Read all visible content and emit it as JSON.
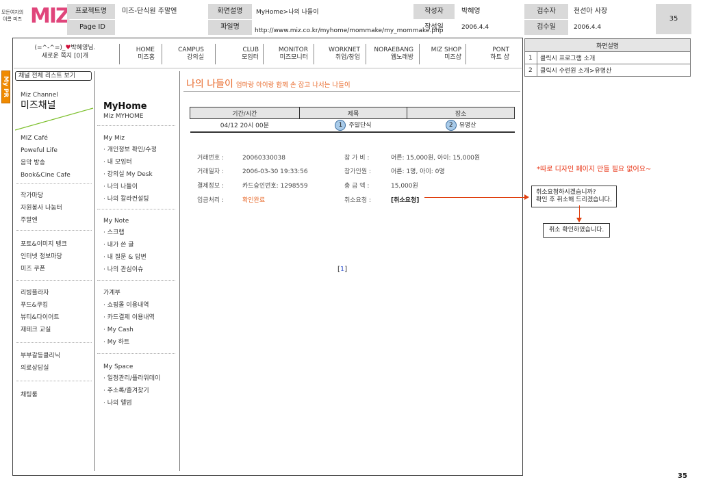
{
  "header": {
    "logo_line1": "모든여자의",
    "logo_line2": "이름 미즈",
    "logo_text": "MIZ",
    "project_label": "프로젝트명",
    "project_value": "미즈-단식원 주말엔",
    "screen_desc_label": "화면설명",
    "screen_desc_value": "MyHome>나의 나들이",
    "author_label": "작성자",
    "author_value": "박혜영",
    "reviewer_label": "검수자",
    "reviewer_value": "천선아 사장",
    "page_no": "35",
    "page_id_label": "Page ID",
    "file_label": "파일명",
    "file_value": "http://www.miz.co.kr/myhome/mommake/my_mommake.php",
    "created_label": "작성일",
    "created_value": "2006.4.4",
    "reviewed_label": "검수일",
    "reviewed_value": "2006.4.4"
  },
  "topnav": {
    "user_line1_a": "(=^-^=)_",
    "user_line1_b": "박혜영님.",
    "user_line2": "새로운 쪽지 [0]개",
    "items": [
      {
        "en": "HOME",
        "ko": "미즈홈"
      },
      {
        "en": "CAMPUS",
        "ko": "강의실"
      },
      {
        "en": "CLUB",
        "ko": "모임터"
      },
      {
        "en": "MONITOR",
        "ko": "미즈모니터"
      },
      {
        "en": "WORKNET",
        "ko": "취업/창업"
      },
      {
        "en": "NORAEBANG",
        "ko": "웹노래방"
      },
      {
        "en": "MIZ SHOP",
        "ko": "미즈샵"
      },
      {
        "en": "PONT",
        "ko": "하트 샵"
      }
    ]
  },
  "sidebar": {
    "tab": "My PR",
    "list_button": "채널 전체 리스트 보기",
    "channel_en": "Miz Channel",
    "channel_ko": "미즈채널",
    "group1": [
      "MIZ Café",
      "Poweful Life",
      "음악 방송",
      "Book&Cine Cafe"
    ],
    "group2": [
      "작가마당",
      "자원봉사 나눔터",
      "주말엔"
    ],
    "group3": [
      "포토&이미지 뱅크",
      "인터넷 정보마당",
      "미즈 쿠폰"
    ],
    "group4": [
      "리빙플라자",
      "푸드&쿠킹",
      "뷰티&다이어트",
      "재테크 교실"
    ],
    "group5": [
      "부부갈등클리닉",
      "의료상담실"
    ],
    "group6": [
      "채팅룸"
    ]
  },
  "myhome": {
    "title": "MyHome",
    "subtitle": "Miz MYHOME",
    "mymiz_title": "My Miz",
    "mymiz": [
      "· 개인정보 확인/수정",
      "· 내 모임터",
      "· 강의실 My Desk",
      "· 나의 나들이",
      "· 나의 칼라컨설팅"
    ],
    "mynote_title": "My Note",
    "mynote": [
      "· 스크랩",
      "· 내가 쓴 글",
      "· 내 질문 & 답변",
      "· 나의 관심이슈"
    ],
    "ledger_title": "가계부",
    "ledger": [
      "· 쇼핑몰 이용내역",
      "· 카드결제 이용내역",
      "· My Cash",
      "· My 하트"
    ],
    "myspace_title": "My Space",
    "myspace": [
      "· 일정관리/플라워데이",
      "· 주소록/즐겨찾기",
      "· 나의 앨범"
    ]
  },
  "content": {
    "title": "나의 나들이",
    "subtitle": "엄마랑 아이랑 함께 손 잡고 나서는 나들이",
    "table_headers": [
      "기간/시간",
      "제목",
      "장소"
    ],
    "row": {
      "period": "04/12 20시 00분",
      "marker1": "1",
      "title": "주말단식",
      "marker2": "2",
      "place": "유명산"
    },
    "info_left": [
      {
        "label": "거래번호 :",
        "value": "20060330038"
      },
      {
        "label": "거래일자 :",
        "value": "2006-03-30 19:33:56"
      },
      {
        "label": "결제정보 :",
        "value": "카드승인번호: 1298559"
      },
      {
        "label": "입금처리 :",
        "value": "확인완료"
      }
    ],
    "info_right": [
      {
        "label": "참 가 비 :",
        "value": "어른: 15,000원, 아이: 15,000원"
      },
      {
        "label": "참가인원 :",
        "value": "어른: 1명, 아이: 0명"
      },
      {
        "label": "총 금 액 :",
        "value": "15,000원"
      },
      {
        "label": "취소요청 :",
        "value": "[취소요청]"
      }
    ],
    "pager_left": "[",
    "pager_page": "1",
    "pager_right": "]"
  },
  "right_panel": {
    "header": "화면설명",
    "rows": [
      {
        "n": "1",
        "text": "클릭시 프로그램 소개"
      },
      {
        "n": "2",
        "text": "클릭시 수련원 소개>유명산"
      }
    ],
    "note": "*따로 디자인 페이지 만들 필요 없어요~",
    "confirm_line1": "취소요청하시겠습니까?",
    "confirm_line2": "확인 후 취소해 드리겠습니다.",
    "done": "취소 확인하였습니다."
  },
  "footer": {
    "page_num": "35"
  }
}
